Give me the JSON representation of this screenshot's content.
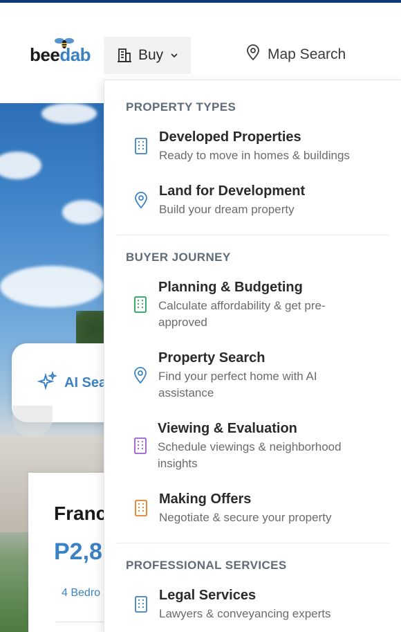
{
  "brand": {
    "logo_text_a": "bee",
    "logo_text_b": "dab"
  },
  "nav": {
    "buy_label": "Buy",
    "map_search_label": "Map Search"
  },
  "hero": {
    "ai_search_label": "AI Sea",
    "listing": {
      "title": "Franc",
      "price": "P2,8",
      "beds": "4 Bedro"
    }
  },
  "dropdown": {
    "sections": [
      {
        "title": "PROPERTY TYPES",
        "items": [
          {
            "title": "Developed Properties",
            "desc": "Ready to move in homes & buildings",
            "icon": "building-icon",
            "color": "#3b82c4"
          },
          {
            "title": "Land for Development",
            "desc": "Build your dream property",
            "icon": "map-pin-icon",
            "color": "#3b82c4"
          }
        ]
      },
      {
        "title": "BUYER JOURNEY",
        "items": [
          {
            "title": "Planning & Budgeting",
            "desc": "Calculate affordability & get pre-approved",
            "icon": "building-icon",
            "color": "#22a55b"
          },
          {
            "title": "Property Search",
            "desc": "Find your perfect home with AI assistance",
            "icon": "map-pin-icon",
            "color": "#3b82c4"
          },
          {
            "title": "Viewing & Evaluation",
            "desc": "Schedule viewings & neighborhood insights",
            "icon": "building-icon",
            "color": "#9b59d6"
          },
          {
            "title": "Making Offers",
            "desc": "Negotiate & secure your property",
            "icon": "building-icon",
            "color": "#e67e22"
          }
        ]
      },
      {
        "title": "PROFESSIONAL SERVICES",
        "items": [
          {
            "title": "Legal Services",
            "desc": "Lawyers & conveyancing experts",
            "icon": "building-icon",
            "color": "#3b82c4"
          }
        ]
      }
    ]
  }
}
